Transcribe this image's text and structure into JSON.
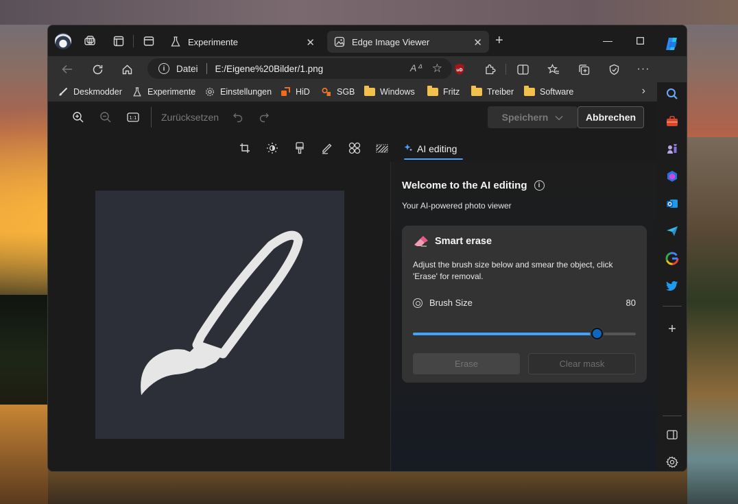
{
  "browser": {
    "tabs": [
      {
        "label": "Experimente",
        "icon": "flask-icon",
        "active": false
      },
      {
        "label": "Edge Image Viewer",
        "icon": "image-icon",
        "active": true
      }
    ],
    "address": {
      "scheme_label": "Datei",
      "url": "E:/Eigene%20Bilder/1.png"
    },
    "bookmarks": [
      {
        "label": "Deskmodder",
        "icon": "brush-icon"
      },
      {
        "label": "Experimente",
        "icon": "flask-icon"
      },
      {
        "label": "Einstellungen",
        "icon": "gear-icon"
      },
      {
        "label": "HiD",
        "icon": "hid-icon"
      },
      {
        "label": "SGB",
        "icon": "sgb-icon"
      },
      {
        "label": "Windows",
        "icon": "folder-icon"
      },
      {
        "label": "Fritz",
        "icon": "folder-icon"
      },
      {
        "label": "Treiber",
        "icon": "folder-icon"
      },
      {
        "label": "Software",
        "icon": "folder-icon"
      }
    ]
  },
  "viewer": {
    "toolbar": {
      "reset_label": "Zurücksetzen",
      "save_label": "Speichern",
      "cancel_label": "Abbrechen"
    },
    "edit_tabs": {
      "ai_label": "AI editing"
    },
    "panel": {
      "title": "Welcome to the AI editing",
      "subtitle": "Your AI-powered photo viewer",
      "card": {
        "title": "Smart erase",
        "description": "Adjust the brush size below and smear the object, click 'Erase' for removal.",
        "brush_label": "Brush Size",
        "brush_value": "80",
        "brush_fraction": 0.8,
        "erase_label": "Erase",
        "clear_label": "Clear mask"
      }
    }
  },
  "colors": {
    "accent": "#3fa3ff",
    "image_bg": "#2c2f37"
  }
}
